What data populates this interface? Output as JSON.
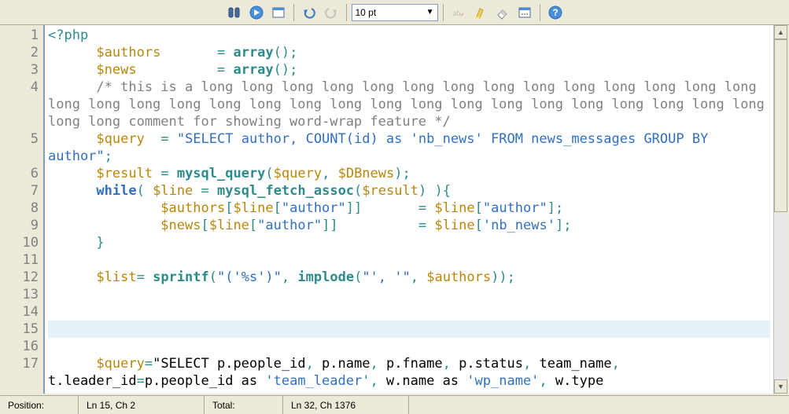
{
  "toolbar": {
    "font_size": "10 pt",
    "icons": [
      "find",
      "go",
      "panel",
      "undo",
      "redo",
      "fontsize",
      "rename",
      "highlight",
      "erase",
      "options",
      "help"
    ]
  },
  "editor": {
    "current_line": 15,
    "lines": [
      {
        "n": 1,
        "raw": "<?php"
      },
      {
        "n": 2,
        "raw": "      $authors       = array();"
      },
      {
        "n": 3,
        "raw": "      $news          = array();"
      },
      {
        "n": 4,
        "raw": "      /* this is a long long long long long long long long long long long long long long long long long long long long long long long long long long long long long long long long long long comment for showing word-wrap feature */"
      },
      {
        "n": 5,
        "raw": "      $query  = \"SELECT author, COUNT(id) as 'nb_news' FROM news_messages GROUP BY author\";"
      },
      {
        "n": 6,
        "raw": "      $result = mysql_query($query, $DBnews);"
      },
      {
        "n": 7,
        "raw": "      while( $line = mysql_fetch_assoc($result) ){"
      },
      {
        "n": 8,
        "raw": "              $authors[$line[\"author\"]]       = $line[\"author\"];"
      },
      {
        "n": 9,
        "raw": "              $news[$line[\"author\"]]          = $line['nb_news'];"
      },
      {
        "n": 10,
        "raw": "      }"
      },
      {
        "n": 11,
        "raw": ""
      },
      {
        "n": 12,
        "raw": "      $list= sprintf(\"('%s')\", implode(\"', '\", $authors));"
      },
      {
        "n": 13,
        "raw": ""
      },
      {
        "n": 14,
        "raw": ""
      },
      {
        "n": 15,
        "raw": "      "
      },
      {
        "n": 16,
        "raw": ""
      },
      {
        "n": 17,
        "raw": "      $query=\"SELECT p.people_id, p.name, p.fname, p.status, team_name, t.leader_id=p.people_id as 'team_leader', w.name as 'wp_name', w.type "
      }
    ]
  },
  "status": {
    "position_label": "Position:",
    "position_value": "Ln 15, Ch 2",
    "total_label": "Total:",
    "total_value": "Ln 32, Ch 1376"
  }
}
